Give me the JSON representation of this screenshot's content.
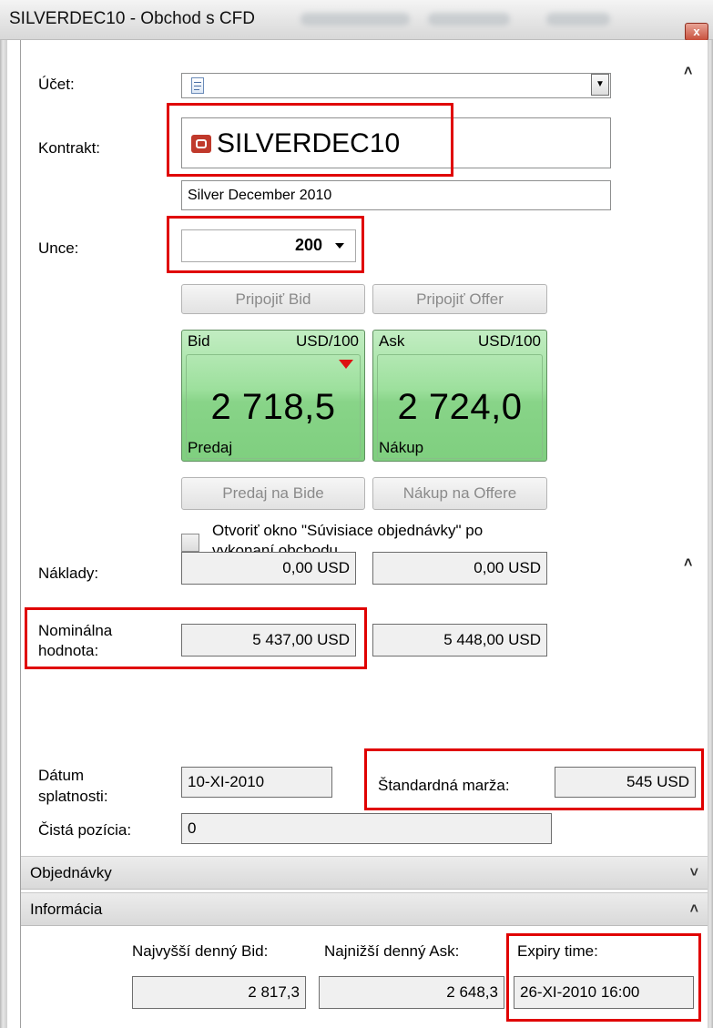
{
  "window": {
    "title": "SILVERDEC10 - Obchod s CFD",
    "close_label": "x"
  },
  "account": {
    "label": "Účet:",
    "value": ""
  },
  "contract": {
    "label": "Kontrakt:",
    "symbol": "SILVERDEC10",
    "description": "Silver December 2010"
  },
  "quantity": {
    "label": "Unce:",
    "value": "200"
  },
  "buttons": {
    "attach_bid": "Pripojiť Bid",
    "attach_offer": "Pripojiť Offer",
    "sell_at_bid": "Predaj na Bide",
    "buy_at_offer": "Nákup na Offere"
  },
  "bid": {
    "header": "Bid",
    "unit": "USD/100",
    "price": "2 718,5",
    "side": "Predaj",
    "trend": "down",
    "trend_color": "#dd1111"
  },
  "ask": {
    "header": "Ask",
    "unit": "USD/100",
    "price": "2 724,0",
    "side": "Nákup"
  },
  "option": {
    "label_line1": "Otvoriť okno \"Súvisiace objednávky\" po",
    "label_line2": "vykonaní obchodu",
    "checked": false
  },
  "costs": {
    "label": "Náklady:",
    "bid_value": "0,00 USD",
    "ask_value": "0,00 USD"
  },
  "notional": {
    "label_line1": "Nominálna",
    "label_line2": "hodnota:",
    "bid_value": "5 437,00 USD",
    "ask_value": "5 448,00 USD"
  },
  "settlement": {
    "label_line1": "Dátum",
    "label_line2": "splatnosti:",
    "value": "10-XI-2010"
  },
  "margin": {
    "label": "Štandardná marža:",
    "value": "545 USD"
  },
  "net_position": {
    "label": "Čistá pozícia:",
    "value": "0"
  },
  "sections": {
    "orders": "Objednávky",
    "information": "Informácia"
  },
  "info": {
    "high_bid_label": "Najvyšší denný Bid:",
    "high_bid_value": "2 817,3",
    "low_ask_label": "Najnižší denný Ask:",
    "low_ask_value": "2 648,3",
    "expiry_label": "Expiry time:",
    "expiry_value": "26-XI-2010 16:00"
  },
  "colors": {
    "highlight": "#e00000",
    "price_tile": "#8fdc8f",
    "contract_icon": "#c0392b"
  }
}
